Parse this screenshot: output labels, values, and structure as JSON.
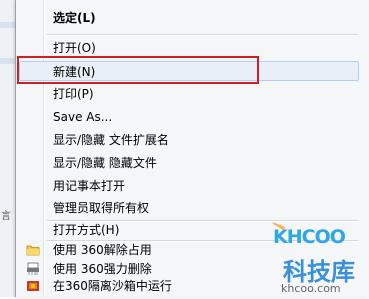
{
  "background": {
    "left_text": "言"
  },
  "menu": {
    "items": [
      {
        "label": "选定(L)",
        "bold": true
      },
      {
        "label": "打开(O)"
      },
      {
        "label": "新建(N)",
        "highlighted": true
      },
      {
        "label": "打印(P)"
      },
      {
        "label": "Save As..."
      },
      {
        "label": "显示/隐藏 文件扩展名"
      },
      {
        "label": "显示/隐藏 隐藏文件"
      },
      {
        "label": "用记事本打开"
      },
      {
        "label": "管理员取得所有权"
      },
      {
        "label": "打开方式(H)"
      },
      {
        "label": "使用 360解除占用",
        "icon": "folder-icon"
      },
      {
        "label": "使用 360强力删除",
        "icon": "shredder-icon"
      },
      {
        "label": "在360隔离沙箱中运行",
        "icon": "sandbox-icon"
      }
    ]
  },
  "watermark": {
    "logo": "KHCOO",
    "title": "科技库",
    "url": "khcoo.com"
  },
  "colors": {
    "highlight_border": "#d21f1f",
    "watermark_blue": "#2fa7e6",
    "watermark_orange": "#ef7b1f"
  }
}
